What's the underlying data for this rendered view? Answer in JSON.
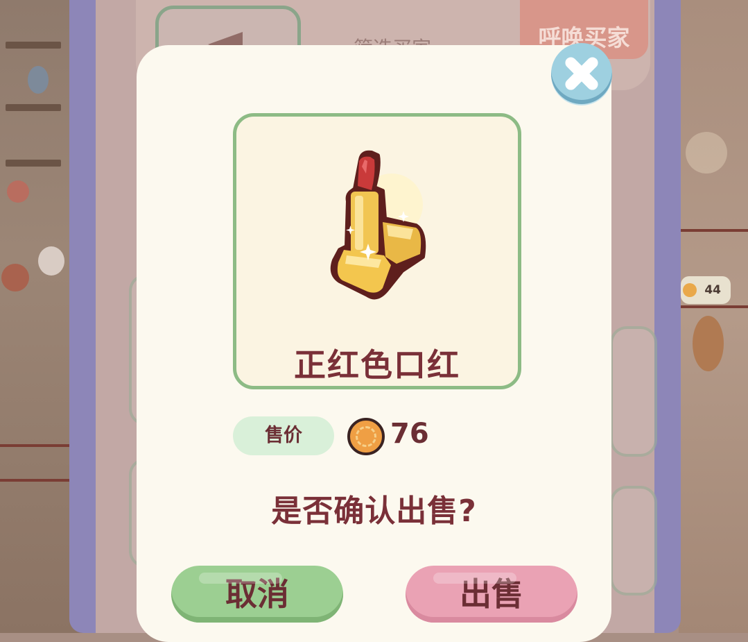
{
  "background": {
    "header_title": "筛选买家",
    "summon_button_label": "呼唤买家",
    "counter_value": "44"
  },
  "dialog": {
    "item_name": "正红色口红",
    "price_label": "售价",
    "price_value": "76",
    "currency_icon": "coin-icon",
    "confirm_question": "是否确认出售?",
    "cancel_label": "取消",
    "sell_label": "出售",
    "close_icon": "close-x-icon"
  },
  "colors": {
    "dialog_bg": "#fcf9ef",
    "text_dark_red": "#7a3038",
    "cancel_green": "#9ccf92",
    "sell_pink": "#eaa2b4",
    "card_border": "#8dbb85",
    "close_blue": "#9ed0e0"
  }
}
